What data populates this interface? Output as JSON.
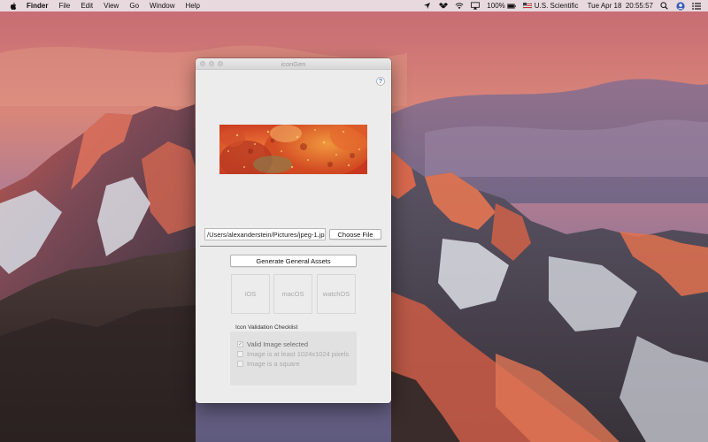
{
  "menubar": {
    "apple_icon": "apple-icon",
    "app_name": "Finder",
    "menus": [
      "File",
      "Edit",
      "View",
      "Go",
      "Window",
      "Help"
    ],
    "battery": "100%",
    "input_source": "U.S. Scientific",
    "datetime": "Tue Apr 18  20:55:57"
  },
  "window": {
    "title": "iconGen",
    "help_label": "?",
    "path_value": "/Users/alexanderstein/Pictures/jpeg-1.jpg",
    "choose_file_label": "Choose File",
    "generate_label": "Generate General Assets",
    "platforms": {
      "ios": "iOS",
      "macos": "macOS",
      "watchos": "watchOS"
    },
    "checklist": {
      "title": "Icon Validation Checklist",
      "items": [
        {
          "label": "Valid Image selected",
          "checked": true
        },
        {
          "label": "Image is at least 1024x1024 pixels",
          "checked": false
        },
        {
          "label": "Image is a square",
          "checked": false
        }
      ]
    }
  },
  "colors": {
    "accent": "#3a76d8",
    "window_bg": "#ececec"
  }
}
